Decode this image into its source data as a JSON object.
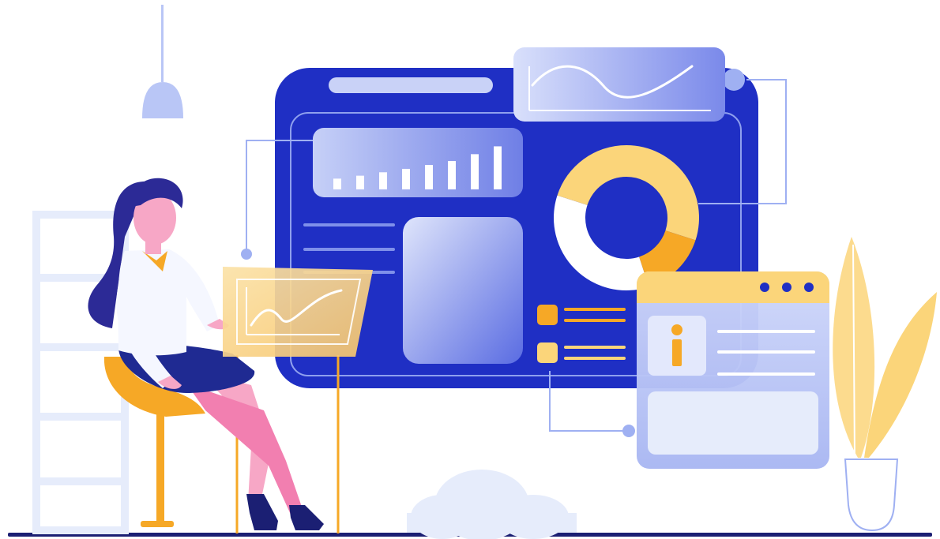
{
  "colors": {
    "primary_blue": "#1f2fc4",
    "deep_navy": "#1b1f73",
    "light_blue": "#b9c6f6",
    "pale_blue": "#e6ecfb",
    "accent_orange": "#f6a826",
    "accent_yellow": "#fbd57a",
    "skin_pink": "#f7a7c6",
    "hair_navy": "#2c2a96",
    "white": "#ffffff"
  },
  "dashboard": {
    "bar_chart": {
      "values": [
        0.22,
        0.28,
        0.35,
        0.42,
        0.5,
        0.58,
        0.72,
        0.88
      ]
    },
    "donut": {
      "segments": [
        0.3,
        0.15,
        0.35,
        0.2
      ]
    },
    "legend_items": 2,
    "info_card": {
      "icon": "info-icon",
      "window_dots": 3
    }
  },
  "icons": {
    "lamp": "ceiling-lamp-icon",
    "plant": "plant-icon",
    "cloud": "cloud-icon",
    "info": "info-icon"
  }
}
